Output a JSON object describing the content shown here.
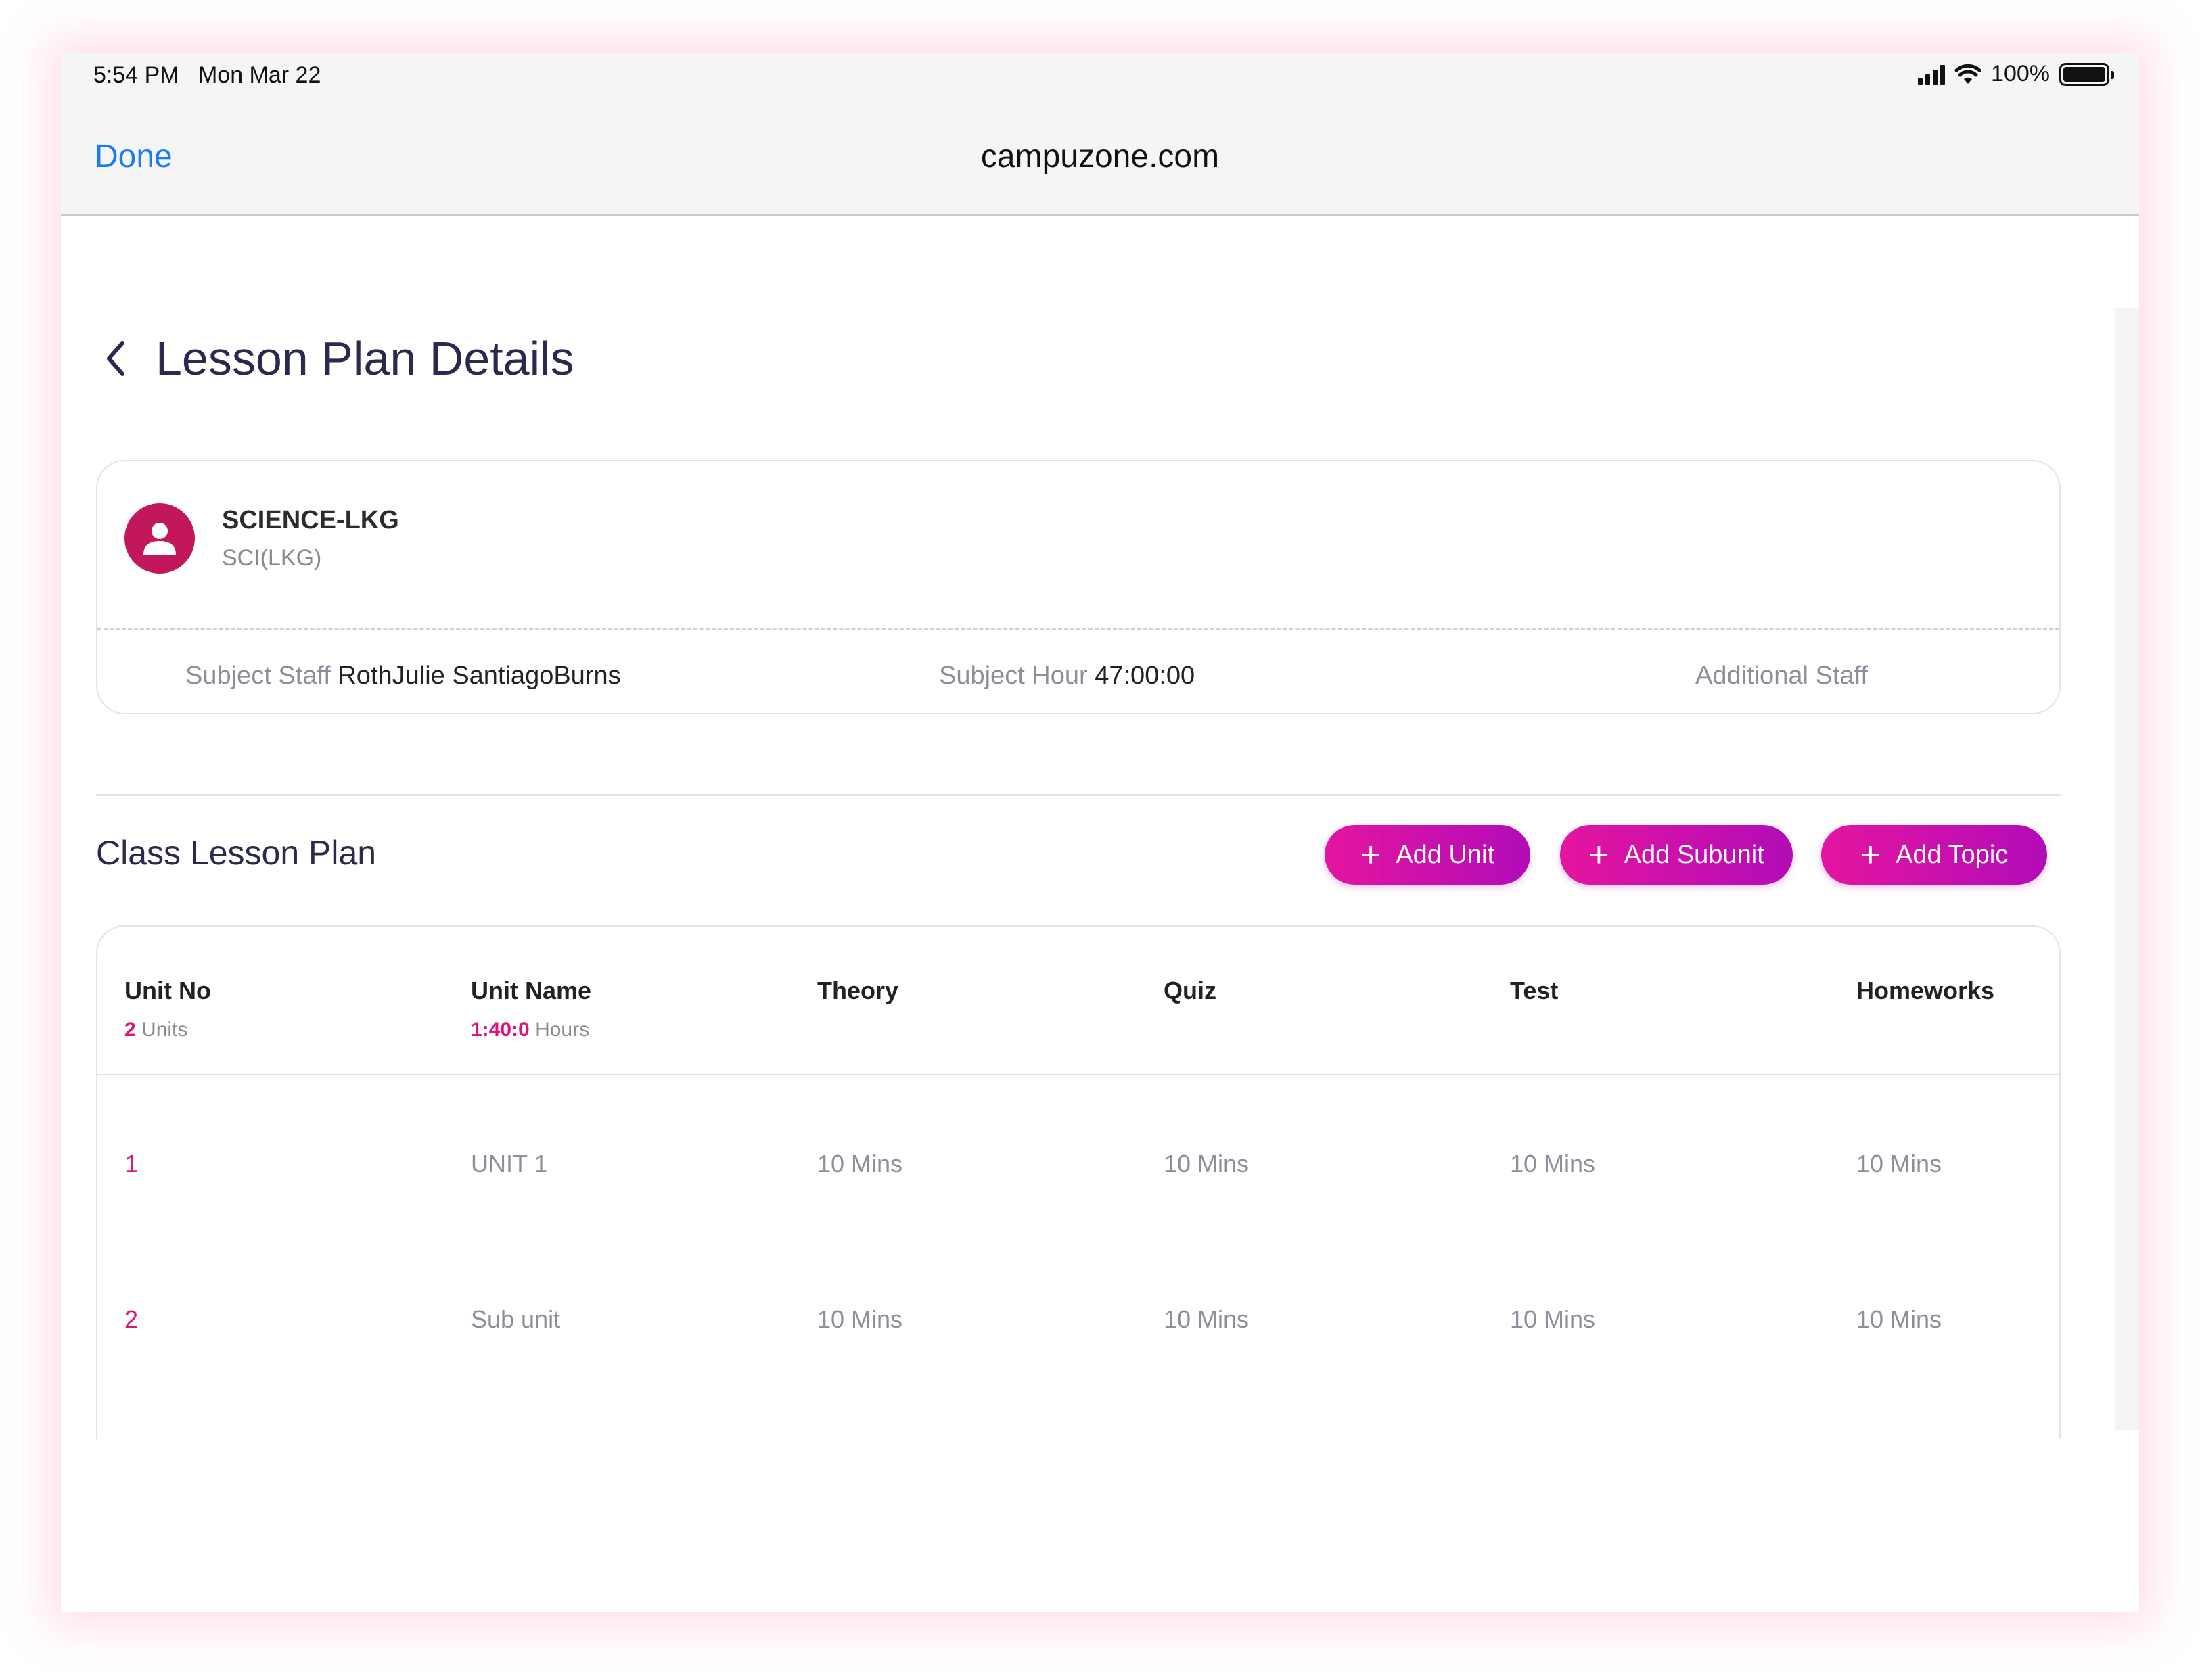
{
  "status_bar": {
    "time": "5:54 PM   Mon Mar 22",
    "battery": "100%"
  },
  "browser": {
    "done_label": "Done",
    "title": "campuzone.com"
  },
  "page": {
    "title": "Lesson Plan Details"
  },
  "subject": {
    "name": "SCIENCE-LKG",
    "code": "SCI(LKG)",
    "staff_label": "Subject Staff",
    "staff_value": "RothJulie SantiagoBurns",
    "hour_label": "Subject Hour",
    "hour_value": "47:00:00",
    "additional_label": "Additional Staff"
  },
  "lesson_plan": {
    "title": "Class Lesson Plan",
    "buttons": {
      "add_unit": "Add Unit",
      "add_subunit": "Add Subunit",
      "add_topic": "Add Topic"
    },
    "columns": [
      "Unit No",
      "Unit Name",
      "Theory",
      "Quiz",
      "Test",
      "Homeworks"
    ],
    "units_count": "2",
    "units_label": "Units",
    "hours_value": "1:40:0",
    "hours_label": "Hours",
    "rows": [
      {
        "no": "1",
        "name": "UNIT 1",
        "theory": "10 Mins",
        "quiz": "10 Mins",
        "test": "10 Mins",
        "homeworks": "10 Mins"
      },
      {
        "no": "2",
        "name": "Sub unit",
        "theory": "10 Mins",
        "quiz": "10 Mins",
        "test": "10 Mins",
        "homeworks": "10 Mins"
      }
    ]
  },
  "colors": {
    "accent_pink": "#e0157a",
    "button_start": "#e5159f",
    "button_end": "#b10cb8",
    "ios_blue": "#1a7cf4",
    "avatar": "#c2185b"
  }
}
